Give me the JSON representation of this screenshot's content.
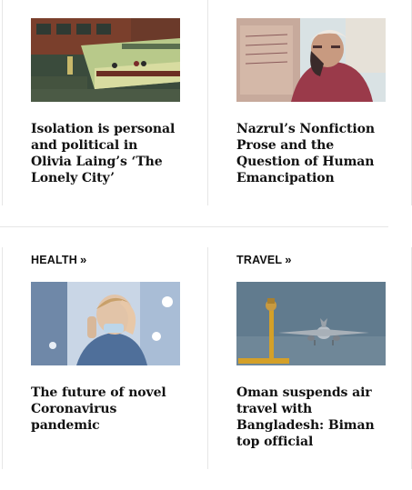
{
  "top_row": {
    "left": {
      "title": "Isolation is personal and political in Olivia Laing’s ‘The Lonely City’"
    },
    "right": {
      "title": "Nazrul’s Nonfiction Prose and the Question of Human Emancipation"
    }
  },
  "bottom_row": {
    "left": {
      "category": "HEALTH",
      "chevron": "»",
      "title": "The future of novel Coronavirus pandemic"
    },
    "right": {
      "category": "TRAVEL",
      "chevron": "»",
      "title": "Oman suspends air travel with Bangladesh: Biman top official"
    }
  }
}
